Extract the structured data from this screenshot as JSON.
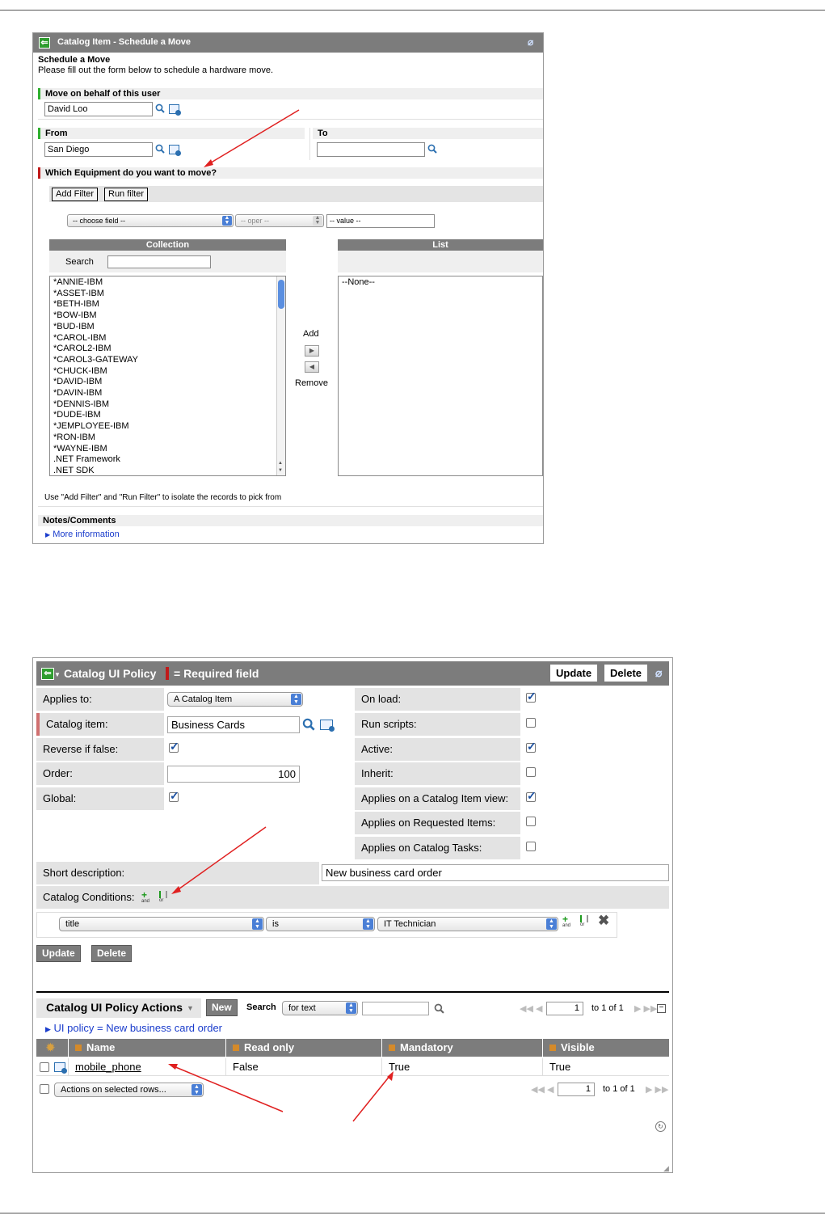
{
  "panel1": {
    "title": "Catalog Item - Schedule a Move",
    "heading": "Schedule a Move",
    "instructions": "Please fill out the form below to schedule a hardware move.",
    "behalf": {
      "label": "Move on behalf of this user",
      "value": "David Loo"
    },
    "from": {
      "label": "From",
      "value": "San Diego"
    },
    "to": {
      "label": "To",
      "value": ""
    },
    "equipment": {
      "label": "Which Equipment do you want to move?",
      "add_filter": "Add Filter",
      "run_filter": "Run filter",
      "choose_field": "-- choose field --",
      "oper": "-- oper --",
      "value": "-- value --",
      "collection_header": "Collection",
      "search_label": "Search",
      "list_header": "List",
      "collection_items": [
        "*ANNIE-IBM",
        "*ASSET-IBM",
        "*BETH-IBM",
        "*BOW-IBM",
        "*BUD-IBM",
        "*CAROL-IBM",
        "*CAROL2-IBM",
        "*CAROL3-GATEWAY",
        "*CHUCK-IBM",
        "*DAVID-IBM",
        "*DAVIN-IBM",
        "*DENNIS-IBM",
        "*DUDE-IBM",
        "*JEMPLOYEE-IBM",
        "*RON-IBM",
        "*WAYNE-IBM",
        ".NET Framework",
        ".NET SDK"
      ],
      "list_items": [
        "--None--"
      ],
      "add_label": "Add",
      "remove_label": "Remove",
      "hint": "Use \"Add Filter\" and \"Run Filter\" to isolate the records to pick from"
    },
    "notes": {
      "label": "Notes/Comments",
      "more": "More information"
    }
  },
  "panel2": {
    "title": "Catalog UI Policy",
    "required_note": "= Required field",
    "update": "Update",
    "delete": "Delete",
    "fields_left": [
      {
        "label": "Applies to:",
        "type": "select",
        "value": "A Catalog Item"
      },
      {
        "label": "Catalog item:",
        "type": "ref",
        "value": "Business Cards"
      },
      {
        "label": "Reverse if false:",
        "type": "check",
        "checked": true
      },
      {
        "label": "Order:",
        "type": "number",
        "value": "100"
      },
      {
        "label": "Global:",
        "type": "check",
        "checked": true
      }
    ],
    "fields_right": [
      {
        "label": "On load:",
        "checked": true
      },
      {
        "label": "Run scripts:",
        "checked": false
      },
      {
        "label": "Active:",
        "checked": true
      },
      {
        "label": "Inherit:",
        "checked": false
      },
      {
        "label": "Applies on a Catalog Item view:",
        "checked": true
      },
      {
        "label": "Applies on Requested Items:",
        "checked": false
      },
      {
        "label": "Applies on Catalog Tasks:",
        "checked": false
      }
    ],
    "short_description": {
      "label": "Short description:",
      "value": "New business card order"
    },
    "conditions": {
      "label": "Catalog Conditions:",
      "field": "title",
      "operator": "is",
      "value": "IT Technician",
      "and_text": "and",
      "or_text": "or"
    },
    "actions": {
      "title": "Catalog UI Policy Actions",
      "new": "New",
      "search_label": "Search",
      "search_select": "for text",
      "page": "1",
      "of_text": "to 1 of 1",
      "breadcrumb": "UI policy = New business card order",
      "columns": [
        "Name",
        "Read only",
        "Mandatory",
        "Visible"
      ],
      "rows": [
        {
          "name": "mobile_phone",
          "read_only": "False",
          "mandatory": "True",
          "visible": "True"
        }
      ],
      "actions_select": "Actions on selected rows..."
    },
    "colors": {
      "header": "#7c7c7c",
      "required": "#c01919",
      "mandatory_green": "#2fb02f",
      "link": "#1a3ccc",
      "arrow": "#e02020"
    }
  }
}
